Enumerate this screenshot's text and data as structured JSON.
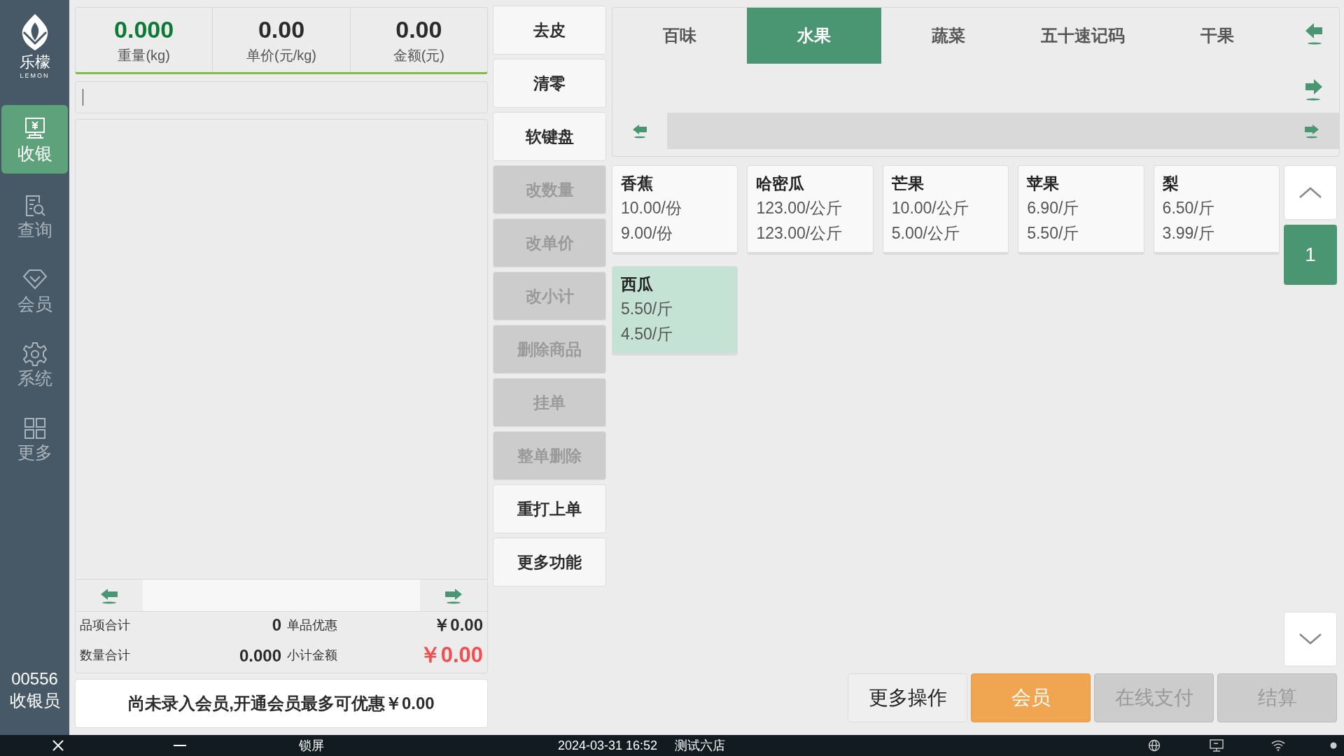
{
  "logo": {
    "name": "乐檬",
    "subtitle": "LEMON"
  },
  "sidebar": {
    "items": [
      {
        "label": "收银",
        "selected": true
      },
      {
        "label": "查询",
        "selected": false
      },
      {
        "label": "会员",
        "selected": false
      },
      {
        "label": "系统",
        "selected": false
      },
      {
        "label": "更多",
        "selected": false
      }
    ],
    "footer": {
      "operator_id": "00556",
      "role": "收银员"
    }
  },
  "readouts": [
    {
      "value": "0.000",
      "label": "重量(kg)",
      "kind": "weight"
    },
    {
      "value": "0.00",
      "label": "单价(元/kg)",
      "kind": "plain"
    },
    {
      "value": "0.00",
      "label": "金额(元)",
      "kind": "plain"
    }
  ],
  "totals": [
    {
      "label": "品项合计",
      "value": "0",
      "kind": "plain"
    },
    {
      "label": "单品优惠",
      "value": "￥0.00",
      "kind": "plain"
    },
    {
      "label": "数量合计",
      "value": "0.000",
      "kind": "plain"
    },
    {
      "label": "小计金额",
      "value": "￥0.00",
      "kind": "emphasis"
    }
  ],
  "member_banner": "尚未录入会员,开通会员最多可优惠￥0.00",
  "actions": [
    {
      "label": "去皮",
      "disabled": false
    },
    {
      "label": "清零",
      "disabled": false
    },
    {
      "label": "软键盘",
      "disabled": false
    },
    {
      "label": "改数量",
      "disabled": true
    },
    {
      "label": "改单价",
      "disabled": true
    },
    {
      "label": "改小计",
      "disabled": true
    },
    {
      "label": "删除商品",
      "disabled": true
    },
    {
      "label": "挂单",
      "disabled": true
    },
    {
      "label": "整单删除",
      "disabled": true
    },
    {
      "label": "重打上单",
      "disabled": false
    },
    {
      "label": "更多功能",
      "disabled": false
    }
  ],
  "category_tabs": [
    {
      "label": "百味",
      "selected": false
    },
    {
      "label": "水果",
      "selected": true
    },
    {
      "label": "蔬菜",
      "selected": false
    },
    {
      "label": "五十速记码",
      "selected": false
    },
    {
      "label": "干果",
      "selected": false
    }
  ],
  "products": [
    {
      "name": "香蕉",
      "price": "10.00/份",
      "member_price": "9.00/份",
      "selected": false
    },
    {
      "name": "哈密瓜",
      "price": "123.00/公斤",
      "member_price": "123.00/公斤",
      "selected": false
    },
    {
      "name": "芒果",
      "price": "10.00/公斤",
      "member_price": "5.00/公斤",
      "selected": false
    },
    {
      "name": "苹果",
      "price": "6.90/斤",
      "member_price": "5.50/斤",
      "selected": false
    },
    {
      "name": "梨",
      "price": "6.50/斤",
      "member_price": "3.99/斤",
      "selected": false
    },
    {
      "name": "西瓜",
      "price": "5.50/斤",
      "member_price": "4.50/斤",
      "selected": true
    }
  ],
  "pager": {
    "page": "1"
  },
  "bottom_buttons": [
    {
      "label": "更多操作",
      "kind": "normal",
      "disabled": false
    },
    {
      "label": "会员",
      "kind": "accent",
      "disabled": false
    },
    {
      "label": "在线支付",
      "kind": "normal",
      "disabled": true
    },
    {
      "label": "结算",
      "kind": "normal",
      "disabled": true
    }
  ],
  "status_bar": {
    "lock": "锁屏",
    "datetime": "2024-03-31 16:52",
    "store": "测试六店"
  }
}
